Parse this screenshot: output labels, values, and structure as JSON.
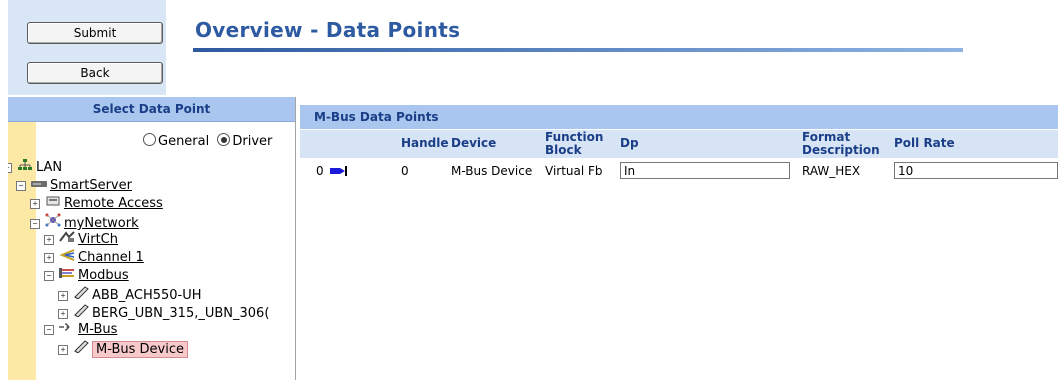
{
  "toolbar": {
    "submit_label": "Submit",
    "back_label": "Back"
  },
  "page": {
    "title": "Overview - Data Points"
  },
  "left_panel": {
    "header": "Select Data Point",
    "radio_general": "General",
    "radio_driver": "Driver",
    "selected_radio": "Driver",
    "tree": [
      {
        "label": "LAN",
        "icon": "lan-network-icon"
      },
      {
        "label": "SmartServer",
        "icon": "server-icon"
      },
      {
        "label": "Remote Access",
        "icon": "remote-access-icon"
      },
      {
        "label": "myNetwork",
        "icon": "network-icon"
      },
      {
        "label": "VirtCh",
        "icon": "virtual-channel-icon"
      },
      {
        "label": "Channel 1",
        "icon": "channel-icon"
      },
      {
        "label": "Modbus",
        "icon": "modbus-icon"
      },
      {
        "label": "ABB_ACH550-UH",
        "icon": "device-icon"
      },
      {
        "label": "BERG_UBN_315,_UBN_306(",
        "icon": "device-icon"
      },
      {
        "label": "M-Bus",
        "icon": "mbus-icon"
      },
      {
        "label": "M-Bus Device",
        "icon": "device-icon"
      }
    ]
  },
  "right_panel": {
    "header": "M-Bus Data Points",
    "columns": {
      "handle": "Handle",
      "device": "Device",
      "function_block_1": "Function",
      "function_block_2": "Block",
      "dp": "Dp",
      "format_1": "Format",
      "format_2": "Description",
      "poll_rate": "Poll Rate"
    },
    "rows": [
      {
        "index": "0",
        "handle": "0",
        "device": "M-Bus Device",
        "function_block": "Virtual Fb",
        "dp": "In",
        "format": "RAW_HEX",
        "poll_rate": "10"
      }
    ]
  },
  "colors": {
    "accent": "#2d5aa0",
    "panel_header": "#a9c7ee",
    "tree_stripe": "#fde9a6",
    "selected": "#f7c9cb"
  }
}
